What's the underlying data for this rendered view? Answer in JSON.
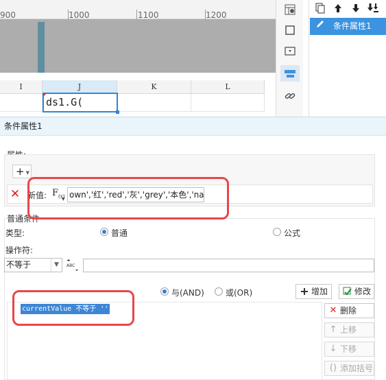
{
  "ruler": {
    "labels": [
      "900",
      "1000",
      "1100",
      "1200"
    ]
  },
  "sheet": {
    "columns": [
      "I",
      "J",
      "K",
      "L"
    ],
    "active_cell_text": "ds1.G("
  },
  "toolstrip": {
    "icons": [
      "cell-attribute-icon",
      "border-icon",
      "widget-icon",
      "condition-attribute-icon",
      "hyperlink-icon"
    ]
  },
  "condition_list": {
    "toolbar_icons": [
      "add-icon",
      "move-up-icon",
      "move-down-icon",
      "move-bottom-icon"
    ],
    "items": [
      {
        "label": "条件属性1",
        "selected": true
      }
    ]
  },
  "dialog": {
    "title": "条件属性1",
    "attributes": {
      "section_label": "属性:",
      "add_button": "+",
      "row": {
        "label": "新值:",
        "fx_label": "F(x)",
        "formula_value": "own','红','red','灰','grey','本色','nature')"
      }
    },
    "condition": {
      "section_label": "普通条件",
      "type_label": "类型:",
      "type_options": [
        {
          "label": "普通",
          "checked": true
        },
        {
          "label": "公式",
          "checked": false
        }
      ],
      "operator_label": "操作符:",
      "operator_value": "不等于",
      "value": "",
      "logic_options": [
        {
          "label": "与(AND)",
          "checked": true
        },
        {
          "label": "或(OR)",
          "checked": false
        }
      ],
      "add_button": "增加",
      "modify_button": "修改",
      "expression": "currentValue 不等于 ''",
      "side_buttons": {
        "delete": "删除",
        "move_up": "上移",
        "move_down": "下移",
        "add_brackets": "添加括号"
      }
    }
  },
  "colors": {
    "accent": "#3c93e0",
    "selection": "#3d86d6",
    "annotation": "#e8464a",
    "delete_red": "#d22222"
  }
}
